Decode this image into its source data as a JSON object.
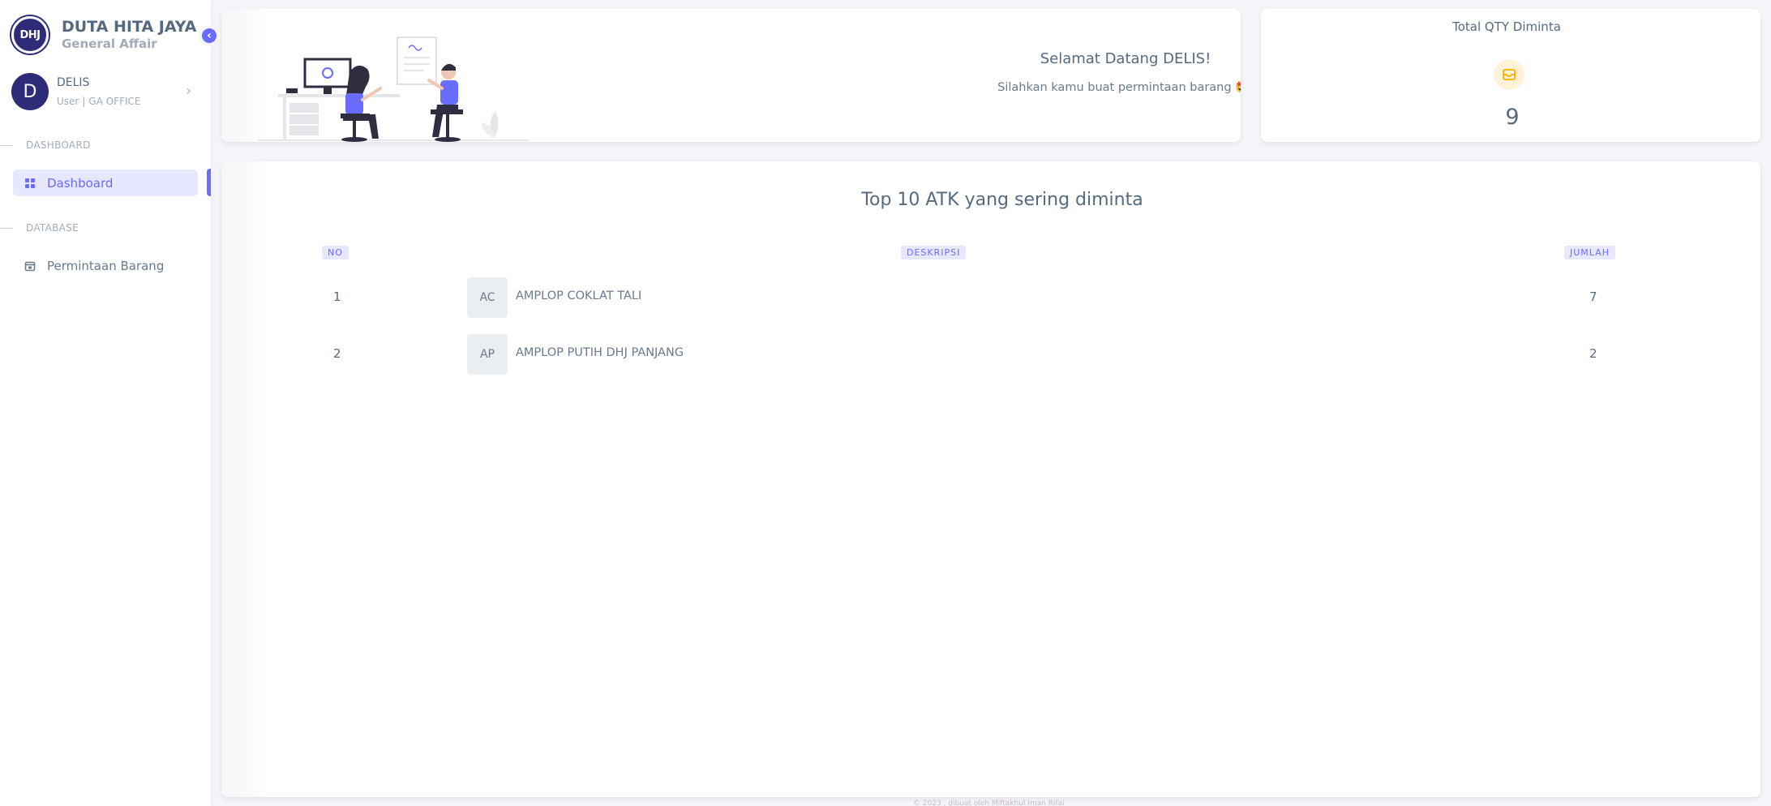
{
  "brand": {
    "logo_text": "DHJ",
    "title": "DUTA HITA JAYA",
    "subtitle": "General Affair"
  },
  "user": {
    "initial": "D",
    "name": "DELIS",
    "role": "User",
    "office": "GA OFFICE"
  },
  "menu": {
    "sections": [
      {
        "header": "DASHBOARD",
        "items": [
          {
            "label": "Dashboard",
            "icon": "dashboard-grid-icon",
            "active": true
          }
        ]
      },
      {
        "header": "DATABASE",
        "items": [
          {
            "label": "Permintaan Barang",
            "icon": "calendar-box-icon",
            "active": false
          }
        ]
      }
    ]
  },
  "welcome": {
    "heading": "Selamat Datang DELIS!",
    "message": "Silahkan kamu buat permintaan barang 🤩."
  },
  "qty": {
    "title": "Total QTY Diminta",
    "icon": "inbox-icon",
    "value": "9",
    "icon_color": "#ffab00"
  },
  "top_items": {
    "title": "Top 10 ATK yang sering diminta",
    "columns": {
      "no": "NO",
      "desc": "DESKRIPSI",
      "qty": "JUMLAH"
    },
    "rows": [
      {
        "no": "1",
        "abbr": "AC",
        "desc": "AMPLOP COKLAT TALI",
        "qty": "7"
      },
      {
        "no": "2",
        "abbr": "AP",
        "desc": "AMPLOP PUTIH DHJ PANJANG",
        "qty": "2"
      }
    ]
  },
  "footer": {
    "text": "© 2023 , dibuat oleh Miftakhul Iman Rifai"
  },
  "colors": {
    "accent": "#696cff",
    "brand": "#2e2b78",
    "text": "#566a7f",
    "muted": "#a1acb8",
    "background": "#f5f5f9"
  }
}
